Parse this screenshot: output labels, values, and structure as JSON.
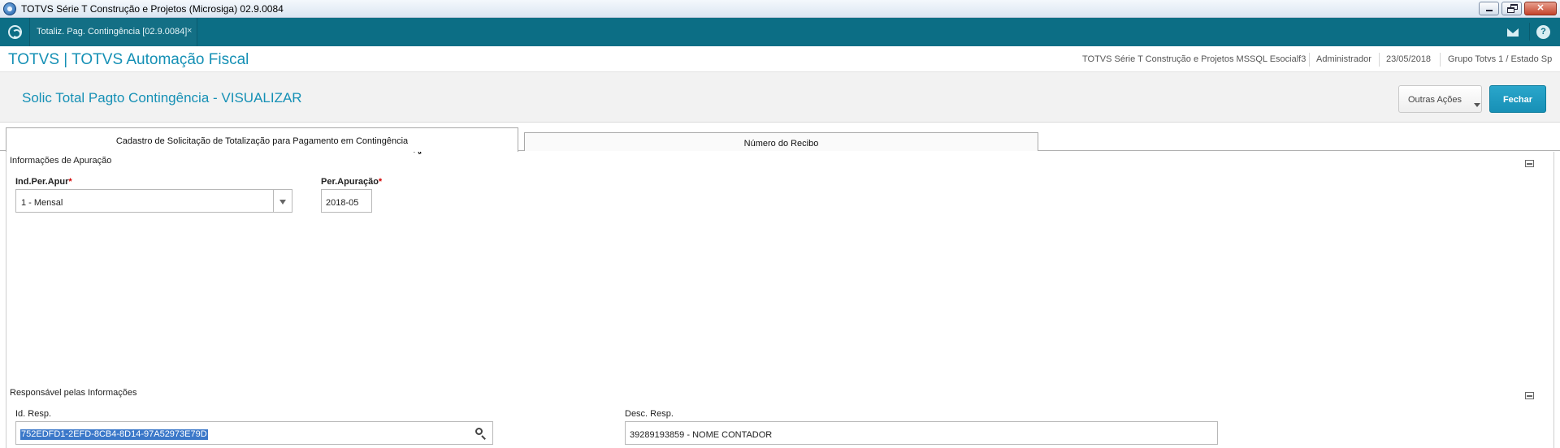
{
  "window": {
    "title": "TOTVS Série T Construção e Projetos (Microsiga) 02.9.0084",
    "minimize_glyph": "",
    "close_glyph": "✕"
  },
  "app_tab": {
    "label": "Totaliz. Pag. Contingência [02.9.0084]",
    "close": "×"
  },
  "header": {
    "brand": "TOTVS | TOTVS Automação Fiscal",
    "environment": "TOTVS Série T Construção e Projetos MSSQL Esocialf3",
    "user": "Administrador",
    "date": "23/05/2018",
    "company": "Grupo Totvs 1 / Estado Sp",
    "help": "?"
  },
  "page": {
    "title": "Solic Total Pagto Contingência - VISUALIZAR",
    "other_actions": "Outras Ações",
    "close_button": "Fechar"
  },
  "tabs": [
    {
      "label": "Cadastro de Solicitação de Totalização para Pagamento em Contingência",
      "active": true
    },
    {
      "label": "Número do Recibo",
      "active": false
    }
  ],
  "section_apuracao": {
    "title": "Informações de Apuração",
    "ind_per_apur": {
      "label": "Ind.Per.Apur",
      "required_mark": "*",
      "value": "1 - Mensal"
    },
    "per_apuracao": {
      "label": "Per.Apuração",
      "required_mark": "*",
      "value": "2018-05"
    }
  },
  "section_responsavel": {
    "title": "Responsável pelas Informações",
    "id_resp": {
      "label": "Id. Resp.",
      "value": "752EDFD1-2EFD-8CB4-8D14-97A52973E79D"
    },
    "desc_resp": {
      "label": "Desc. Resp.",
      "value": "39289193859 - NOME CONTADOR"
    }
  },
  "colors": {
    "tabbar_bg": "#0c6e85",
    "accent": "#1590b5",
    "primary_button": "#1790b6",
    "required": "#d30000",
    "selection": "#3b78c9"
  }
}
